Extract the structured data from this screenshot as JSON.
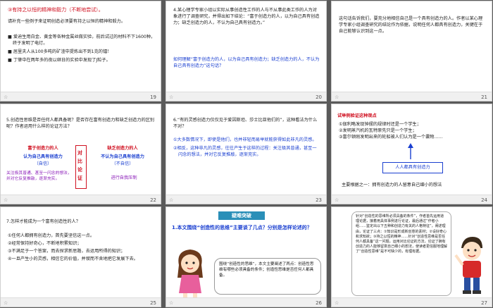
{
  "slides": [
    {
      "num": "19",
      "heading": "③有持之以恒的精神和毅力（不断地尝试）。",
      "intro": "请补充一些例子来证明创造必须要有持之以恒的精神和毅力。",
      "items": [
        "爱迪生用白金、黄金等各种金属丝做实验，前后试过的材料不下1600种，终于发明了电灯。",
        "居里夫人从100多吨的矿渣中提炼出不到1克的镭！",
        "丁肇中在两年多的夜以继日的实验中发现了J粒子。"
      ]
    },
    {
      "num": "20",
      "body": "4.某心理学专家小组以实际从事创造性工作的人与不从事此类工作的人为对象进行了调查研究，并得出如下结论：“富于创造力的人，以为自己具有创造力；缺乏创造力的人，不认为自己具有创造力。”",
      "question": "如何理解“富于创造力的人，以为自己具有创造力；缺乏创造力的人，不认为自己具有创造力”这句话？"
    },
    {
      "num": "21",
      "body": "这句话告诉我们，要充分地相信自己是一个具有创造力的人。作者以某心理学专家小组调查研究的结论作为依据，说明任何人都具有创造力，关键在于自己能够认识到这一点。"
    },
    {
      "num": "22",
      "question": "5.创造性思维是否任何人都具备呢？是否存在富有创造力和缺乏创造力的区别呢？作者运用什么样的论证方法？",
      "left_title": "富于创造力的人",
      "left_sub1": "认为自己具有创造力",
      "left_sub2": "（自信）",
      "left_note": "关注极其普通、甚至一闪念的想法，并对它反复推敲，逐渐充实。",
      "center": "对比论证",
      "right_title": "缺乏创造力的人",
      "right_sub1": "不认为自己具有创造力",
      "right_sub2": "（不自信）",
      "right_note": "进行自我压制"
    },
    {
      "num": "23",
      "question": "6.“有的灵感创造力仅仅见于爱因斯坦、莎士比亚他们的”，这种看法为什么不对？",
      "items": [
        "①大多数情况下，即使是他们，也并非轻而易举就能获得如此非凡的灵感。",
        "②相反，这种非凡的灵感，往往产生于这样的过程：关注极其普通，甚至一闪念的想法，并对它反复推敲，逐渐充实。"
      ]
    },
    {
      "num": "24",
      "heading": "试举例验证这种观点",
      "items": [
        "①伽利略发现钟摆的规律时还是一个学生；",
        "②发明蒸汽机的瓦特原先只是一个学生；",
        "③富尔顿刚发明出来的轮船被人们认为是一个囊物……"
      ],
      "box": "人人都具有创造力",
      "conclusion": "主要根据之一：拥有创造力的人留意自己细小的想法"
    },
    {
      "num": "25",
      "question": "7.怎样才能成为一个富有创造性的人？",
      "items": [
        "①任何人都拥有创造力，首先要坚信这一点。",
        "②经常保持好奇心，不断地积累知识；",
        "③不满足于一个答案，而去探求新思路，去运用所得的知识；",
        "④一旦产生小的灵感，相信它的价值，并锲而不舍地把它发展下去。"
      ]
    },
    {
      "num": "26",
      "banner": "疑难突破",
      "question": "1.本文围绕“创造性的思维”主要谈了几点？分别是怎样论述的？",
      "bubble": "围绕“创造性的思维”，本文主要阐述了两点：创造性思维有哪些必须具备的条件；创造性思维是否任何人都具备。"
    },
    {
      "num": "27",
      "bubble": "针对“创造性的思维所必须具备的条件”，作者首先运用道理论据，接着用具体事例进行论证，最后通过“作者小组……鉴定出以下五种和创造力有关的人格特征”，阐述理由，论证了三点：①知识是形成新创意的素材；②设好奇心和求知欲；③持之以恒的精神……针对“创造性思维是否任何人都具备”这一问题，运用对比论证的方法，论证了拥有创造力的人能够留意自己细小的想法，使读者更信服地理解了“创造性思维”是不可缺少的，有理有据。"
    }
  ],
  "colors": {
    "accent_red": "#d01020",
    "accent_blue": "#1a3fd0",
    "banner_teal": "#2a8fb8",
    "star_yellow": "#f2b21d"
  },
  "icons": [
    "star-icon",
    "girl-cartoon-icon",
    "boy-cartoon-icon",
    "arrow-up-icon"
  ]
}
